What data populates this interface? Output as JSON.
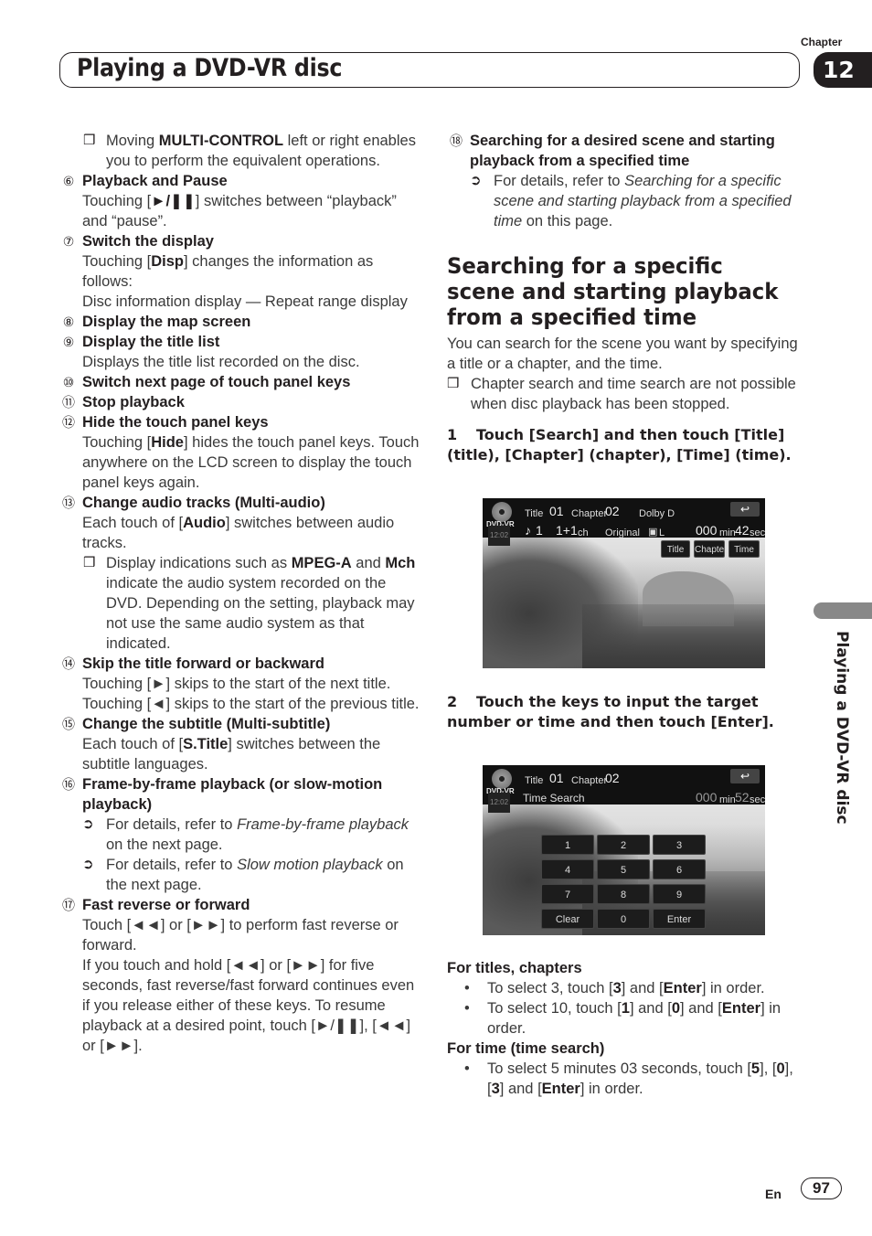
{
  "header": {
    "chapter_label": "Chapter",
    "chapter_number": "12",
    "title": "Playing a DVD-VR disc"
  },
  "left_column": {
    "note_multicontrol": {
      "glyph": "❒",
      "pre": "Moving ",
      "bold": "MULTI-CONTROL",
      "post": " left or right enables you to perform the equivalent operations."
    },
    "items": [
      {
        "num": "⑥",
        "head": "Playback and Pause",
        "body_pre": "Touching [",
        "body_bold": "►/❚❚",
        "body_post": "] switches between “playback” and “pause”."
      },
      {
        "num": "⑦",
        "head": "Switch the display",
        "body_pre": "Touching [",
        "body_bold": "Disp",
        "body_post": "] changes the information as follows:",
        "extra": "Disc information display — Repeat range display"
      },
      {
        "num": "⑧",
        "head": "Display the map screen"
      },
      {
        "num": "⑨",
        "head": "Display the title list",
        "body": "Displays the title list recorded on the disc."
      },
      {
        "num": "⑩",
        "head": "Switch next page of touch panel keys"
      },
      {
        "num": "⑪",
        "head": "Stop playback"
      },
      {
        "num": "⑫",
        "head": "Hide the touch panel keys",
        "body_pre": "Touching [",
        "body_bold": "Hide",
        "body_post": "] hides the touch panel keys. Touch anywhere on the LCD screen to display the touch panel keys again."
      },
      {
        "num": "⑬",
        "head": "Change audio tracks (Multi-audio)",
        "body_pre": "Each touch of [",
        "body_bold": "Audio",
        "body_post": "] switches between audio tracks."
      },
      {
        "num": "⑭",
        "head": "Skip the title forward or backward",
        "body": "Touching [►] skips to the start of the next title. Touching [◄] skips to the start of the previous title."
      },
      {
        "num": "⑮",
        "head": "Change the subtitle (Multi-subtitle)",
        "body_pre": "Each touch of [",
        "body_bold": "S.Title",
        "body_post": "] switches between the subtitle languages."
      },
      {
        "num": "⑯",
        "head": "Frame-by-frame playback (or slow-motion playback)"
      },
      {
        "num": "⑰",
        "head": "Fast reverse or forward",
        "body": "Touch [◄◄] or [►►] to perform fast reverse or forward.",
        "extra": "If you touch and hold [◄◄] or [►►] for five seconds, fast reverse/fast forward continues even if you release either of these keys. To resume playback at a desired point, touch [►/❚❚], [◄◄] or [►►]."
      }
    ],
    "note_mpeg": {
      "glyph": "❒",
      "t1": "Display indications such as ",
      "b1": "MPEG-A",
      "t2": " and ",
      "b2": "Mch",
      "t3": " indicate the audio system recorded on the DVD. Depending on the setting, playback may not use the same audio system as that indicated."
    },
    "refs_16": [
      {
        "glyph": "➲",
        "pre": "For details, refer to ",
        "ital": "Frame-by-frame playback",
        "post": " on the next page."
      },
      {
        "glyph": "➲",
        "pre": "For details, refer to ",
        "ital": "Slow motion playback",
        "post": " on the next page."
      }
    ]
  },
  "right_column": {
    "item_18": {
      "num": "⑱",
      "head": "Searching for a desired scene and starting playback from a specified time",
      "ref_glyph": "➲",
      "ref_pre": "For details, refer to ",
      "ref_ital": "Searching for a specific scene and starting playback from a specified time",
      "ref_post": " on this page."
    },
    "section_title": "Searching for a specific scene and starting playback from a specified time",
    "intro": "You can search for the scene you want by specifying a title or a chapter, and the time.",
    "note": {
      "glyph": "❒",
      "text": "Chapter search and time search are not possible when disc playback has been stopped."
    },
    "step1": {
      "num": "1",
      "text": "Touch [Search] and then touch [Title] (title), [Chapter] (chapter), [Time] (time)."
    },
    "screen1": {
      "source_label": "DVD-VR",
      "clock": "12:02",
      "title_label": "Title",
      "title_value": "01",
      "chapter_label": "Chapter",
      "chapter_value": "02",
      "audio_format": "Dolby D",
      "audio_icon": "♪",
      "audio_track": "1",
      "channels": "1+1",
      "channels_unit": "ch",
      "original": "Original",
      "subtitle_icon": "▣",
      "subtitle_value": "L",
      "time_min": "000",
      "min_label": "min",
      "time_sec": "42",
      "sec_label": "sec",
      "back_icon": "↩",
      "buttons": [
        "Title",
        "Chapter",
        "Time"
      ]
    },
    "step2": {
      "num": "2",
      "text": "Touch the keys to input the target number or time and then touch [Enter]."
    },
    "screen2": {
      "source_label": "DVD-VR",
      "clock": "12:02",
      "title_label": "Title",
      "title_value": "01",
      "chapter_label": "Chapter",
      "chapter_value": "02",
      "mode": "Time Search",
      "time_min": "000",
      "min_label": "min",
      "time_sec": "52",
      "sec_label": "sec",
      "back_icon": "↩",
      "keys": [
        "1",
        "2",
        "3",
        "4",
        "5",
        "6",
        "7",
        "8",
        "9",
        "Clear",
        "0",
        "Enter"
      ]
    },
    "for_titles": {
      "head": "For titles, chapters",
      "b1_pre": "To select 3, touch [",
      "b1_k1": "3",
      "b1_mid": "] and [",
      "b1_k2": "Enter",
      "b1_post": "] in order.",
      "b2_pre": "To select 10, touch [",
      "b2_k1": "1",
      "b2_m1": "] and [",
      "b2_k2": "0",
      "b2_m2": "] and [",
      "b2_k3": "Enter",
      "b2_post": "] in order."
    },
    "for_time": {
      "head": "For time (time search)",
      "b_pre": "To select 5 minutes 03 seconds, touch [",
      "k1": "5",
      "m1": "], [",
      "k2": "0",
      "m2": "], [",
      "k3": "3",
      "m3": "] and [",
      "k4": "Enter",
      "post": "] in order."
    },
    "bullet": "•"
  },
  "side_tab": {
    "text": "Playing a DVD-VR disc"
  },
  "footer": {
    "lang": "En",
    "page": "97"
  }
}
